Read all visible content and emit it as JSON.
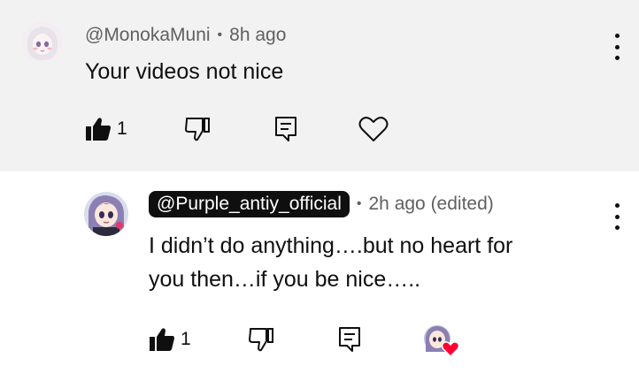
{
  "top_comment": {
    "handle": "@MonokaMuni",
    "separator": "•",
    "time": "8h ago",
    "text": "Your videos not nice",
    "like_count": "1",
    "avatar_icon": "anime-girl-avatar",
    "like_icon": "thumbs-up-filled-icon",
    "dislike_icon": "thumbs-down-outline-icon",
    "reply_icon": "reply-comment-icon",
    "heart_icon": "heart-outline-icon",
    "menu_icon": "kebab-menu-icon"
  },
  "reply_comment": {
    "handle": "@Purple_antiy_official",
    "separator": "•",
    "time": "2h ago (edited)",
    "text_line1": "I didn’t do anything….but no heart for",
    "text_line2": "you then…if you be nice…..",
    "like_count": "1",
    "avatar_icon": "purple-character-avatar",
    "like_icon": "thumbs-up-filled-icon",
    "dislike_icon": "thumbs-down-outline-icon",
    "reply_icon": "reply-comment-icon",
    "creator_heart_icon": "creator-heart-badge-icon",
    "menu_icon": "kebab-menu-icon"
  },
  "colors": {
    "top_background": "#f2f2f2",
    "reply_background": "#ffffff",
    "handle_pill": "#0f0f0f",
    "meta_text": "#606060",
    "heart_red": "#ff0033"
  }
}
